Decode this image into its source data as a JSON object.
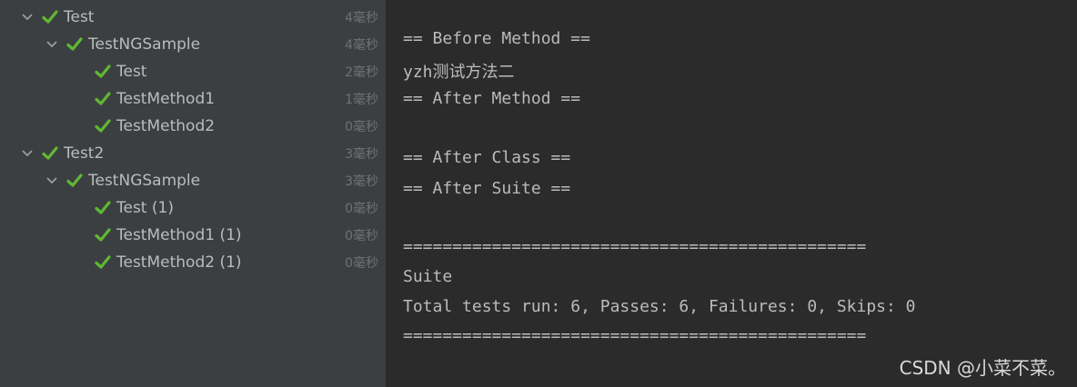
{
  "tree": {
    "rows": [
      {
        "label": "Test",
        "time": "4毫秒"
      },
      {
        "label": "TestNGSample",
        "time": "4毫秒"
      },
      {
        "label": "Test",
        "time": "2毫秒"
      },
      {
        "label": "TestMethod1",
        "time": "1毫秒"
      },
      {
        "label": "TestMethod2",
        "time": "0毫秒"
      },
      {
        "label": "Test2",
        "time": "3毫秒"
      },
      {
        "label": "TestNGSample",
        "time": "3毫秒"
      },
      {
        "label": "Test (1)",
        "time": "0毫秒"
      },
      {
        "label": "TestMethod1 (1)",
        "time": "0毫秒"
      },
      {
        "label": "TestMethod2 (1)",
        "time": "0毫秒"
      }
    ]
  },
  "console": {
    "lines": [
      "== Before Method ==",
      "yzh测试方法二",
      "== After Method ==",
      "",
      "== After Class ==",
      "== After Suite ==",
      "",
      "===============================================",
      "Suite",
      "Total tests run: 6, Passes: 6, Failures: 0, Skips: 0",
      "==============================================="
    ]
  },
  "watermark": "CSDN @小菜不菜。",
  "colors": {
    "tree_bg": "#3c3f41",
    "console_bg": "#2b2b2b",
    "text": "#bbbbbb",
    "check_green": "#5fb832",
    "time_gray": "#6f7275"
  },
  "icons": {
    "expand": "chevron-down-icon",
    "status": "checkmark-icon"
  }
}
